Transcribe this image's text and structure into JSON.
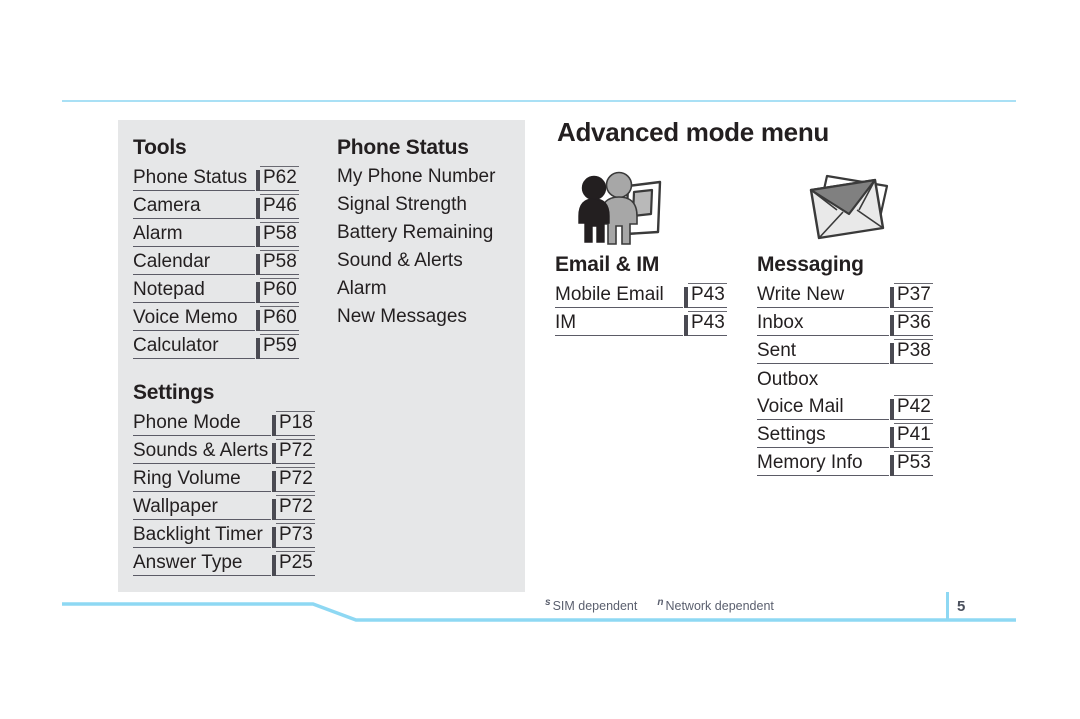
{
  "page": {
    "heading": "Advanced mode menu",
    "folio": "5",
    "accent_color": "#8ed8f3",
    "panel_color": "#e6e7e8",
    "text_color": "#231f20"
  },
  "footnotes": [
    {
      "marker": "s",
      "text": "SIM dependent"
    },
    {
      "marker": "n",
      "text": "Network dependent"
    }
  ],
  "sections": {
    "tools": {
      "title": "Tools",
      "items": [
        {
          "label": "Phone Status",
          "page": "P62"
        },
        {
          "label": "Camera",
          "page": "P46"
        },
        {
          "label": "Alarm",
          "page": "P58"
        },
        {
          "label": "Calendar",
          "page": "P58"
        },
        {
          "label": "Notepad",
          "page": "P60"
        },
        {
          "label": "Voice Memo",
          "page": "P60"
        },
        {
          "label": "Calculator",
          "page": "P59"
        }
      ]
    },
    "phone_status": {
      "title": "Phone Status",
      "items": [
        {
          "label": "My Phone Number"
        },
        {
          "label": "Signal Strength"
        },
        {
          "label": "Battery Remaining"
        },
        {
          "label": "Sound & Alerts"
        },
        {
          "label": "Alarm"
        },
        {
          "label": "New Messages"
        }
      ]
    },
    "settings": {
      "title": "Settings",
      "items": [
        {
          "label": "Phone Mode",
          "page": "P18"
        },
        {
          "label": "Sounds & Alerts",
          "page": "P72"
        },
        {
          "label": "Ring Volume",
          "page": "P72"
        },
        {
          "label": "Wallpaper",
          "page": "P72"
        },
        {
          "label": "Backlight Timer",
          "page": "P73"
        },
        {
          "label": "Answer Type",
          "page": "P25"
        }
      ]
    },
    "email_im": {
      "title": "Email & IM",
      "icon": "two-people-screen-icon",
      "items": [
        {
          "label": "Mobile Email",
          "page": "P43"
        },
        {
          "label": "IM",
          "page": "P43"
        }
      ]
    },
    "messaging": {
      "title": "Messaging",
      "icon": "envelope-icon",
      "items": [
        {
          "label": "Write New",
          "page": "P37"
        },
        {
          "label": "Inbox",
          "page": "P36"
        },
        {
          "label": "Sent",
          "page": "P38"
        },
        {
          "label": "Outbox",
          "page": ""
        },
        {
          "label": "Voice Mail",
          "page": "P42"
        },
        {
          "label": "Settings",
          "page": "P41"
        },
        {
          "label": "Memory Info",
          "page": "P53"
        }
      ]
    }
  }
}
